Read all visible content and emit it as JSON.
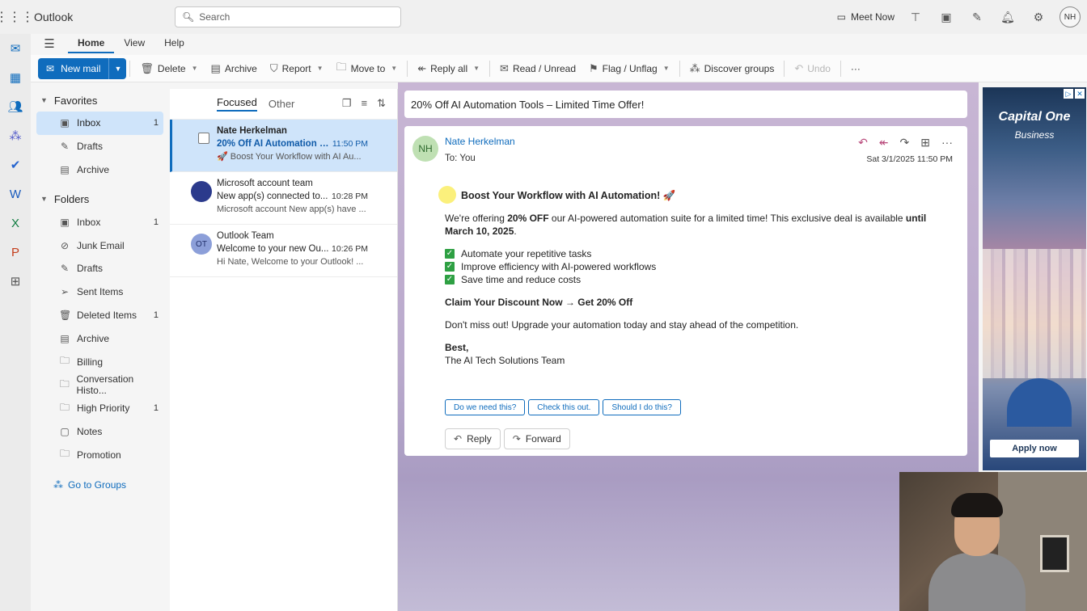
{
  "topbar": {
    "app_title": "Outlook",
    "search_placeholder": "Search",
    "meet_now": "Meet Now",
    "avatar_initials": "NH"
  },
  "ribbon": {
    "tabs": [
      "Home",
      "View",
      "Help"
    ],
    "new_mail": "New mail",
    "delete": "Delete",
    "archive": "Archive",
    "report": "Report",
    "move_to": "Move to",
    "reply_all": "Reply all",
    "read_unread": "Read / Unread",
    "flag_unflag": "Flag / Unflag",
    "discover_groups": "Discover groups",
    "undo": "Undo",
    "more": "···"
  },
  "folders": {
    "favorites_label": "Favorites",
    "favorites": [
      {
        "label": "Inbox",
        "count": "1",
        "icon": "inbox-icon"
      },
      {
        "label": "Drafts",
        "count": "",
        "icon": "drafts-icon"
      },
      {
        "label": "Archive",
        "count": "",
        "icon": "archive-icon"
      }
    ],
    "folders_label": "Folders",
    "items": [
      {
        "label": "Inbox",
        "count": "1"
      },
      {
        "label": "Junk Email",
        "count": ""
      },
      {
        "label": "Drafts",
        "count": ""
      },
      {
        "label": "Sent Items",
        "count": ""
      },
      {
        "label": "Deleted Items",
        "count": "1"
      },
      {
        "label": "Archive",
        "count": ""
      },
      {
        "label": "Billing",
        "count": ""
      },
      {
        "label": "Conversation Histo...",
        "count": ""
      },
      {
        "label": "High Priority",
        "count": "1"
      },
      {
        "label": "Notes",
        "count": ""
      },
      {
        "label": "Promotion",
        "count": ""
      }
    ],
    "go_to_groups": "Go to Groups"
  },
  "message_list": {
    "tab_focused": "Focused",
    "tab_other": "Other",
    "messages": [
      {
        "sender": "Nate Herkelman",
        "subject": "20% Off AI Automation T...",
        "time": "11:50 PM",
        "preview": "🚀 Boost Your Workflow with AI Au..."
      },
      {
        "sender": "Microsoft account team",
        "subject": "New app(s) connected to...",
        "time": "10:28 PM",
        "preview": "Microsoft account New app(s) have ..."
      },
      {
        "sender": "Outlook Team",
        "subject": "Welcome to your new Ou...",
        "time": "10:26 PM",
        "preview": "Hi Nate, Welcome to your Outlook! ...",
        "initials": "OT"
      }
    ]
  },
  "email": {
    "subject": "20% Off AI Automation Tools – Limited Time Offer!",
    "sender_initials": "NH",
    "from": "Nate Herkelman",
    "to": "To:  You",
    "date": "Sat 3/1/2025 11:50 PM",
    "headline": "Boost Your Workflow with AI Automation! 🚀",
    "p1_a": "We're offering ",
    "p1_b": "20% OFF",
    "p1_c": " our AI-powered automation suite for a limited time! This exclusive deal is available ",
    "p1_d": "until March 10, 2025",
    "p1_e": ".",
    "checks": [
      "Automate your repetitive tasks",
      "Improve efficiency with AI-powered workflows",
      "Save time and reduce costs"
    ],
    "cta": "Claim Your Discount Now → Get 20% Off",
    "p2": "Don't miss out! Upgrade your automation today and stay ahead of the competition.",
    "signoff": "Best,",
    "team": "The AI Tech Solutions Team",
    "suggestions": [
      "Do we need this?",
      "Check this out.",
      "Should I do this?"
    ],
    "reply": "Reply",
    "forward": "Forward"
  },
  "ad": {
    "brand": "Capital One",
    "sub": "Business",
    "cta": "Apply now"
  }
}
